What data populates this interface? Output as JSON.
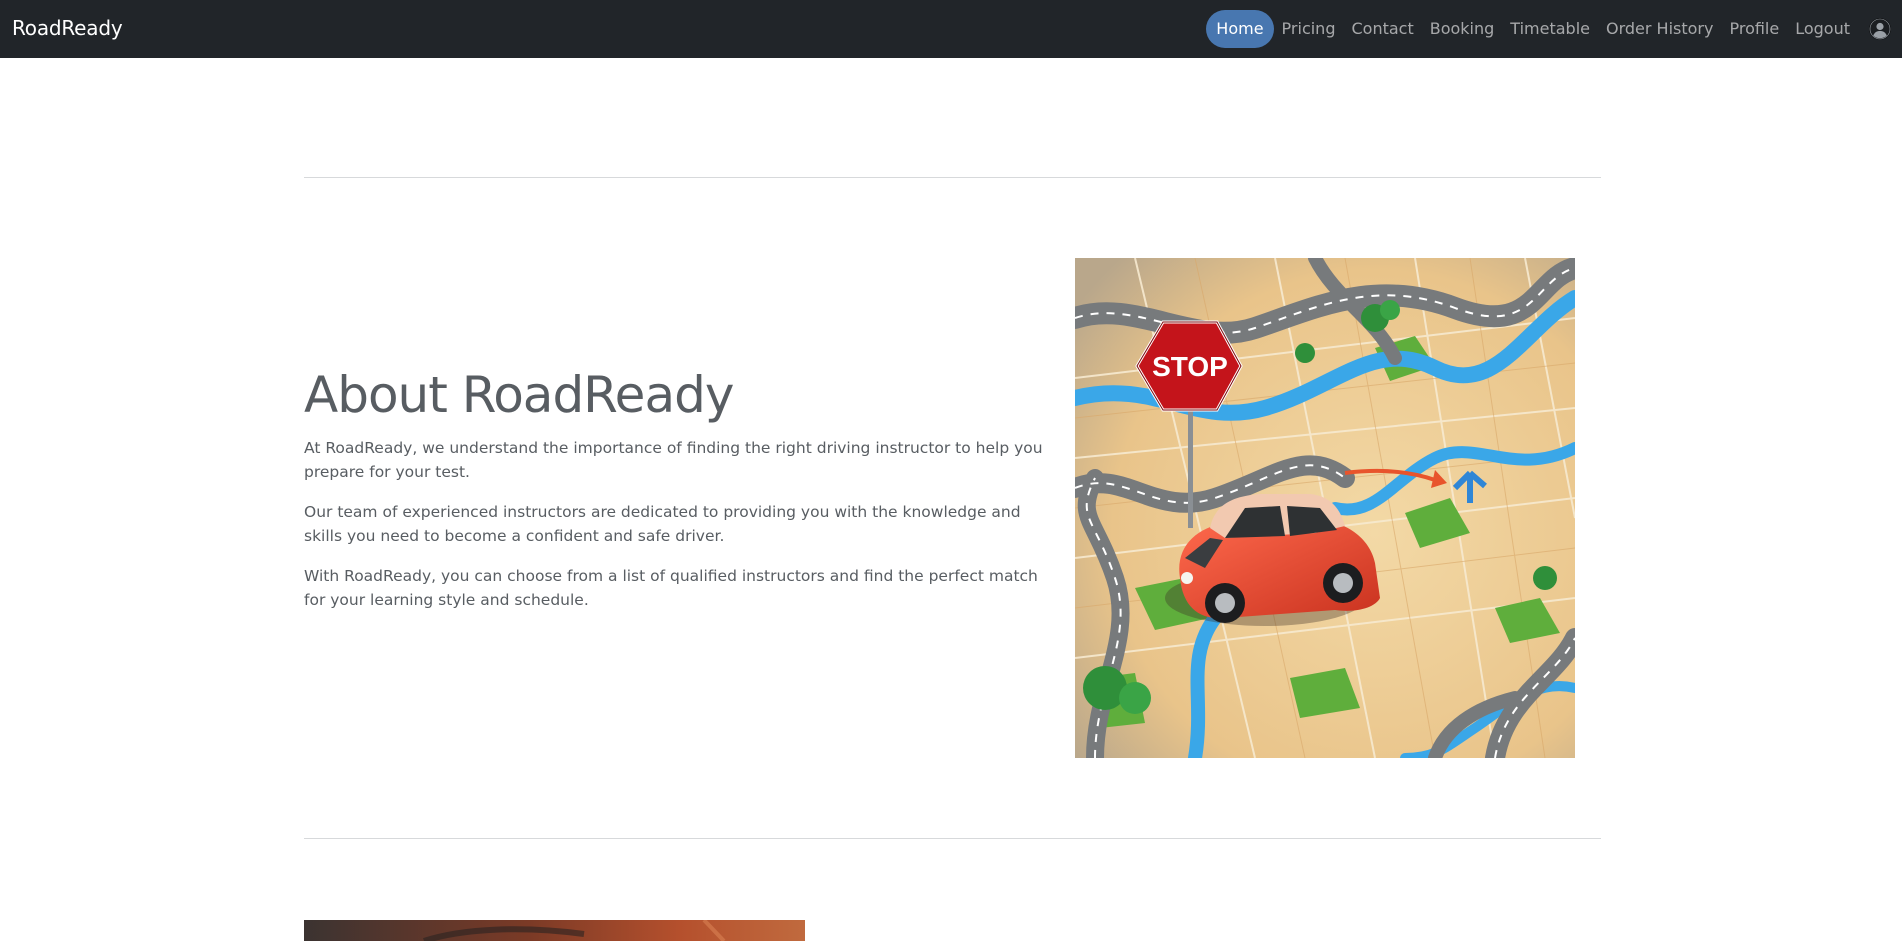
{
  "navbar": {
    "brand": "RoadReady",
    "links": [
      {
        "label": "Home",
        "active": true
      },
      {
        "label": "Pricing"
      },
      {
        "label": "Contact"
      },
      {
        "label": "Booking"
      },
      {
        "label": "Timetable"
      },
      {
        "label": "Order History"
      },
      {
        "label": "Profile"
      },
      {
        "label": "Logout"
      }
    ],
    "avatar_icon": "user-circle-icon"
  },
  "about": {
    "title": "About RoadReady",
    "paragraphs": [
      "At RoadReady, we understand the importance of finding the right driving instructor to help you prepare for your test.",
      "Our team of experienced instructors are dedicated to providing you with the knowledge and skills you need to become a confident and safe driver.",
      "With RoadReady, you can choose from a list of qualified instructors and find the perfect match for your learning style and schedule."
    ],
    "image_sign_text": "STOP"
  },
  "colors": {
    "navbar_bg": "#212529",
    "active_pill": "#4877b0",
    "text": "#585d62"
  }
}
